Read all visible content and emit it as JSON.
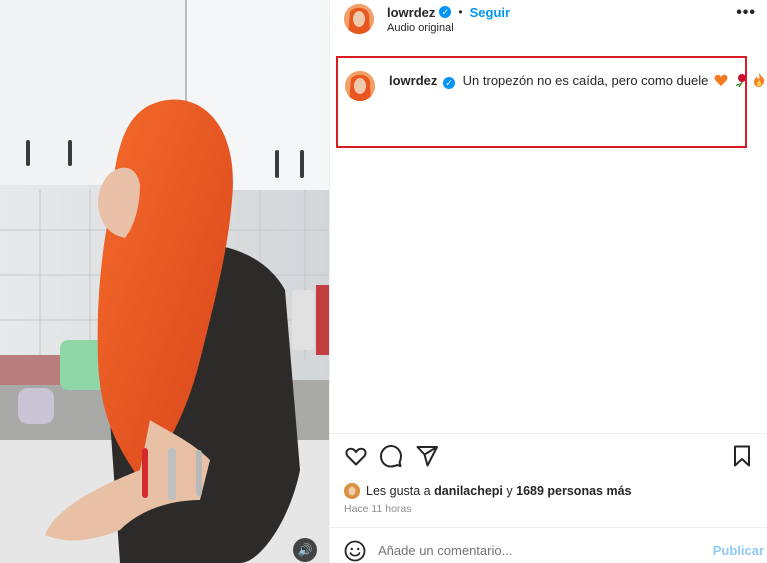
{
  "video": {
    "mute_icon": "speaker-icon"
  },
  "header": {
    "username": "lowrdez",
    "separator": "•",
    "follow_label": "Seguir",
    "audio_label": "Audio original",
    "more_icon": "more-horizontal-icon"
  },
  "caption": {
    "username": "lowrdez",
    "text": "Un tropezón no es caída, pero como duele",
    "emojis": [
      "orange-heart-icon",
      "red-rose-icon",
      "fire-icon"
    ]
  },
  "actions": {
    "like_icon": "heart-icon",
    "comment_icon": "comment-icon",
    "share_icon": "share-icon",
    "save_icon": "bookmark-icon"
  },
  "likes": {
    "prefix": "Les gusta a",
    "liked_by": "danilachepi",
    "joiner": "y",
    "others": "1689 personas más"
  },
  "timestamp": "Hace 11 horas",
  "comment": {
    "placeholder": "Añade un comentario...",
    "publish_label": "Publicar"
  },
  "colors": {
    "accent": "#0095f6",
    "highlight": "#d91c22",
    "hair": "#f05a24",
    "publish_disabled": "#90c9f3"
  }
}
